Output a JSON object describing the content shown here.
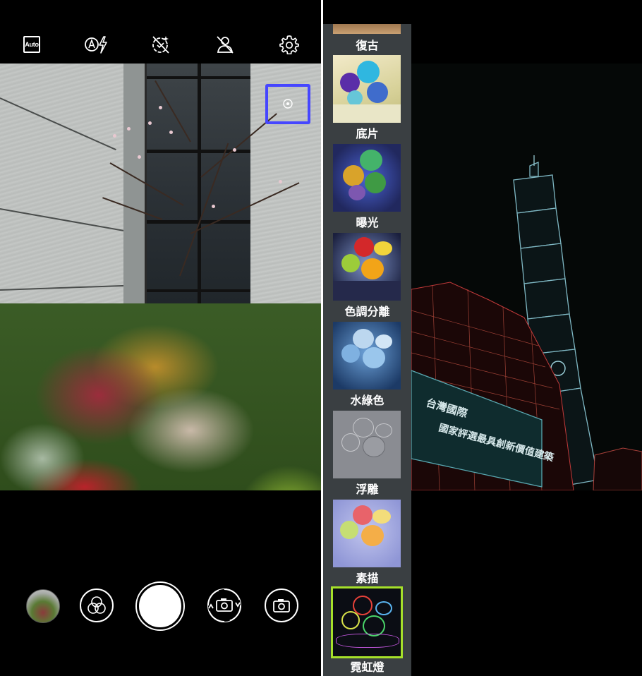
{
  "left_pane": {
    "topbar": {
      "auto_label": "Auto",
      "icons": [
        "auto-mode-icon",
        "auto-flash-icon",
        "beautify-off-icon",
        "timer-off-icon",
        "settings-gear-icon"
      ]
    },
    "viewfinder": {
      "focus_indicator": "focus-box"
    },
    "bottombar": {
      "icons": [
        "gallery-thumbnail",
        "filter-circles-icon",
        "shutter-button",
        "switch-camera-icon",
        "camera-mode-icon"
      ]
    }
  },
  "right_pane": {
    "filters": [
      {
        "label": "復古",
        "selected": false
      },
      {
        "label": "底片",
        "selected": false
      },
      {
        "label": "曝光",
        "selected": false
      },
      {
        "label": "色調分離",
        "selected": false
      },
      {
        "label": "水綠色",
        "selected": false
      },
      {
        "label": "浮雕",
        "selected": false
      },
      {
        "label": "素描",
        "selected": false
      },
      {
        "label": "霓虹燈",
        "selected": true
      }
    ],
    "selected_color": "#a6e12a",
    "scene_sign_text_1": "台灣國際",
    "scene_sign_text_2": "國家評選最具創新價值建築"
  },
  "colors": {
    "focus_box": "#4646ff",
    "selected_outline": "#a6e12a",
    "strip_bg": "#3a3f42"
  }
}
